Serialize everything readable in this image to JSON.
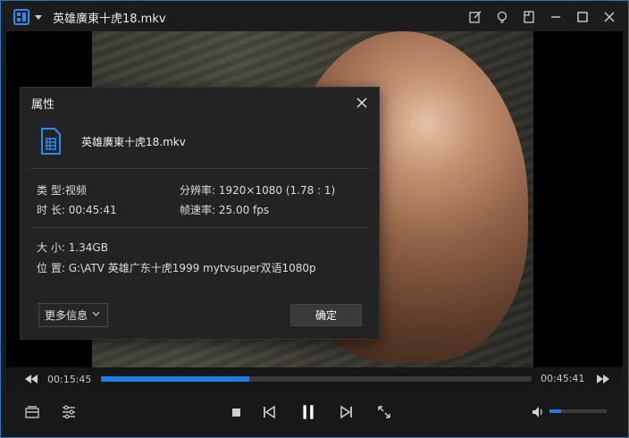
{
  "window": {
    "title": "英雄廣東十虎18.mkv",
    "accent": "#1e7fe6"
  },
  "player": {
    "current_time": "00:15:45",
    "total_time": "00:45:41",
    "progress_fraction": 0.345,
    "volume_fraction": 0.2
  },
  "dialog": {
    "title": "属性",
    "file_name": "英雄廣東十虎18.mkv",
    "props": {
      "type_label": "类 型:",
      "type_value": "视频",
      "duration_label": "时 长:",
      "duration_value": "00:45:41",
      "resolution_label": "分辨率:",
      "resolution_value": "1920×1080 (1.78 : 1)",
      "framerate_label": "帧速率:",
      "framerate_value": "25.00 fps",
      "size_label": "大 小:",
      "size_value": "1.34GB",
      "location_label": "位 置:",
      "location_value": "G:\\ATV 英雄广东十虎1999 mytvsuper双语1080p"
    },
    "more_label": "更多信息",
    "ok_label": "确定"
  },
  "icons": {
    "app_logo": "film-strip-icon",
    "title_actions": [
      "note-edit-icon",
      "lightbulb-icon",
      "pin-window-icon",
      "minimize-icon",
      "maximize-icon",
      "close-icon"
    ],
    "controls": [
      "playlist-icon",
      "settings-sliders-icon",
      "stop-icon",
      "previous-icon",
      "pause-icon",
      "next-icon",
      "fullscreen-icon",
      "volume-icon"
    ]
  }
}
